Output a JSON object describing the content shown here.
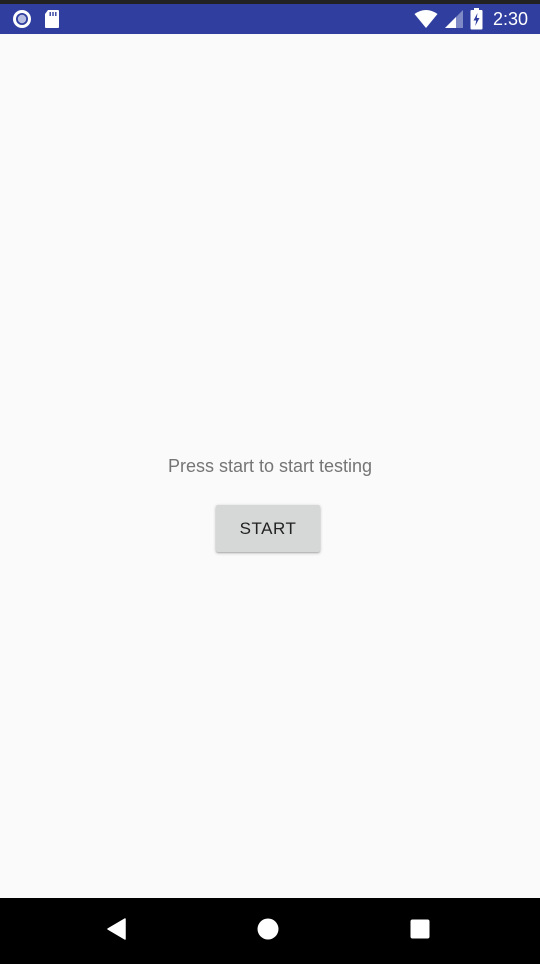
{
  "status_bar": {
    "time": "2:30",
    "background": "#303f9f",
    "left_icons": [
      "record-icon",
      "sd-card-icon"
    ],
    "right_icons": [
      "wifi-icon",
      "cell-signal-icon",
      "battery-charging-icon"
    ]
  },
  "main": {
    "prompt": "Press start to start testing",
    "start_button_label": "START"
  },
  "navigation_bar": {
    "buttons": [
      "back-icon",
      "home-icon",
      "recents-icon"
    ]
  },
  "colors": {
    "status_bar": "#303f9f",
    "background": "#fafafa",
    "button": "#d6d7d7",
    "prompt_text": "#757575",
    "nav_bar": "#000000"
  }
}
